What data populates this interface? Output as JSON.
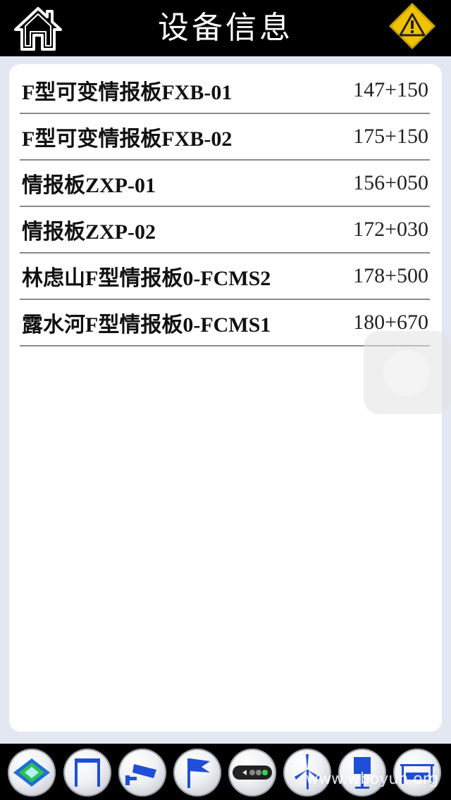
{
  "header": {
    "title": "设备信息",
    "home_icon": "home-icon",
    "warning_icon": "warning-icon"
  },
  "devices": [
    {
      "name": "F型可变情报板FXB-01",
      "position": "147+150"
    },
    {
      "name": "F型可变情报板FXB-02",
      "position": "175+150"
    },
    {
      "name": "情报板ZXP-01",
      "position": "156+050"
    },
    {
      "name": "情报板ZXP-02",
      "position": "172+030"
    },
    {
      "name": "林虑山F型情报板0-FCMS2",
      "position": "178+500"
    },
    {
      "name": "露水河F型情报板0-FCMS1",
      "position": "180+670"
    }
  ],
  "bottom_nav": {
    "items": [
      "map-icon",
      "gantry-icon",
      "camera-icon",
      "flag-icon",
      "traffic-light-icon",
      "wind-turbine-icon",
      "sign-post-icon",
      "barrier-icon"
    ]
  },
  "watermark": "www.wboyun.org",
  "colors": {
    "bar_background": "#000000",
    "page_background": "#e3e7f1",
    "accent_blue": "#1f4fd8",
    "warning_yellow": "#f2c200"
  }
}
